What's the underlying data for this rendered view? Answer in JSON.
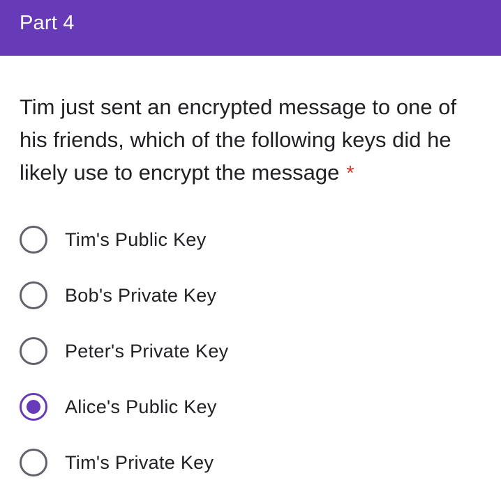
{
  "section": {
    "title": "Part 4"
  },
  "question": {
    "text": "Tim just sent an encrypted message to one of his friends, which of the following keys did he likely use to encrypt the message",
    "required_marker": "*"
  },
  "options": [
    {
      "label": "Tim's Public Key",
      "selected": false
    },
    {
      "label": "Bob's Private Key",
      "selected": false
    },
    {
      "label": "Peter's Private Key",
      "selected": false
    },
    {
      "label": "Alice's Public Key",
      "selected": true
    },
    {
      "label": "Tim's Private Key",
      "selected": false
    }
  ],
  "colors": {
    "header_background": "#673ab7",
    "accent": "#673ab7",
    "radio_unchecked": "#5f6368",
    "required": "#d93025",
    "text": "#202124"
  }
}
